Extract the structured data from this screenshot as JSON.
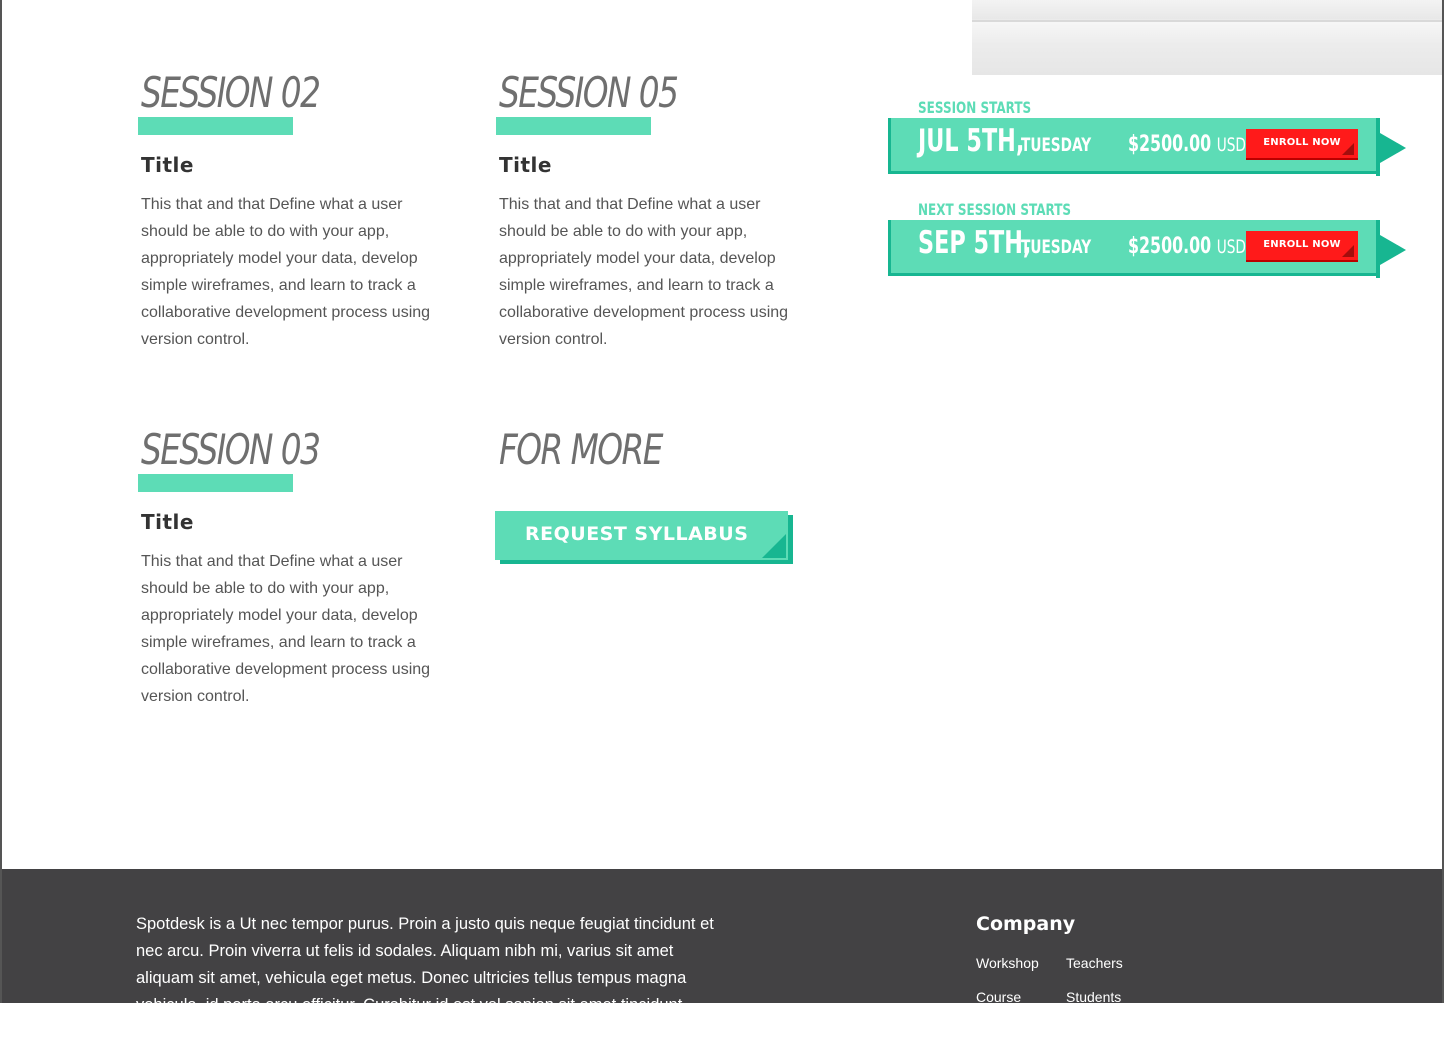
{
  "sessions": [
    {
      "heading": "SESSION 02",
      "title": "Title",
      "description": "This that and that Define what a user should be able to do with your app, appropriately model your data, develop simple wireframes, and learn to track a collaborative development process using version control."
    },
    {
      "heading": "SESSION 05",
      "title": "Title",
      "description": "This that and that Define what a user should be able to do with your app, appropriately model your data, develop simple wireframes, and learn to track a collaborative development process using version control."
    },
    {
      "heading": "SESSION 03",
      "title": "Title",
      "description": "This that and that Define what a user should be able to do with your app, appropriately model your data, develop simple wireframes, and learn to track a collaborative development process using version control."
    }
  ],
  "for_more": {
    "heading": "FOR MORE",
    "button_label": "REQUEST SYLLABUS"
  },
  "enrollment": [
    {
      "label": "SESSION STARTS",
      "date": "JUL 5TH,",
      "day": "TUESDAY",
      "price": "$2500.00",
      "currency": "USD",
      "button_label": "ENROLL NOW"
    },
    {
      "label": "NEXT SESSION STARTS",
      "date": "SEP 5TH,",
      "day": "TUESDAY",
      "price": "$2500.00",
      "currency": "USD",
      "button_label": "ENROLL NOW"
    }
  ],
  "footer": {
    "about": "Spotdesk is a Ut nec tempor purus. Proin a justo quis neque feugiat tincidunt et nec arcu. Proin viverra ut felis id sodales. Aliquam nibh mi, varius sit amet aliquam sit amet, vehicula eget metus. Donec ultricies tellus tempus magna vehicula, id porta arcu efficitur. Curabitur id est vel sapien sit amet tincidunt. Pellentesque",
    "company_heading": "Company",
    "links": [
      "Workshop",
      "Teachers",
      "Course",
      "Students"
    ]
  },
  "colors": {
    "accent": "#5ddcb6",
    "accent_dark": "#17b691",
    "enroll_red": "#ff1a1a",
    "footer_bg": "#434244",
    "heading_gray": "#6f6f6f"
  }
}
